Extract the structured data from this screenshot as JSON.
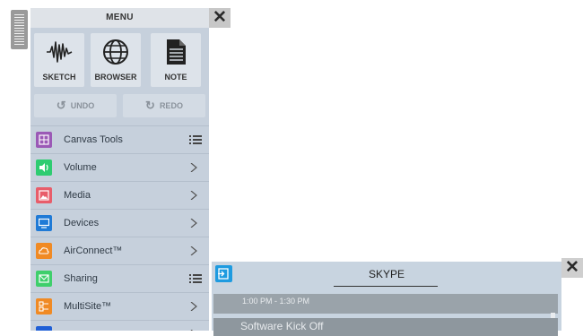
{
  "menu": {
    "title": "MENU",
    "close_icon": "close-icon",
    "buttons": [
      {
        "label": "SKETCH",
        "icon": "waveform-icon"
      },
      {
        "label": "BROWSER",
        "icon": "globe-icon"
      },
      {
        "label": "NOTE",
        "icon": "document-icon"
      }
    ],
    "undo_label": "UNDO",
    "redo_label": "REDO",
    "items": [
      {
        "label": "Canvas Tools",
        "color": "#9b59b6",
        "icon": "grid-icon",
        "trail": "list-icon"
      },
      {
        "label": "Volume",
        "color": "#2ecc71",
        "icon": "speaker-icon",
        "trail": "chevron-right-icon"
      },
      {
        "label": "Media",
        "color": "#e85d6a",
        "icon": "image-icon",
        "trail": "chevron-right-icon"
      },
      {
        "label": "Devices",
        "color": "#1f7ad6",
        "icon": "monitor-icon",
        "trail": "chevron-right-icon"
      },
      {
        "label": "AirConnect™",
        "color": "#f08a24",
        "icon": "cloud-icon",
        "trail": "chevron-right-icon"
      },
      {
        "label": "Sharing",
        "color": "#3fcf6b",
        "icon": "share-icon",
        "trail": "list-icon"
      },
      {
        "label": "MultiSite™",
        "color": "#f08a24",
        "icon": "multisite-icon",
        "trail": "chevron-right-icon"
      },
      {
        "label": "",
        "color": "#1f5fd6",
        "icon": "globe-small-icon",
        "trail": "chevron-right-icon"
      }
    ]
  },
  "skype": {
    "title": "SKYPE",
    "time": "1:00 PM - 1:30 PM",
    "event": "Software Kick Off"
  }
}
